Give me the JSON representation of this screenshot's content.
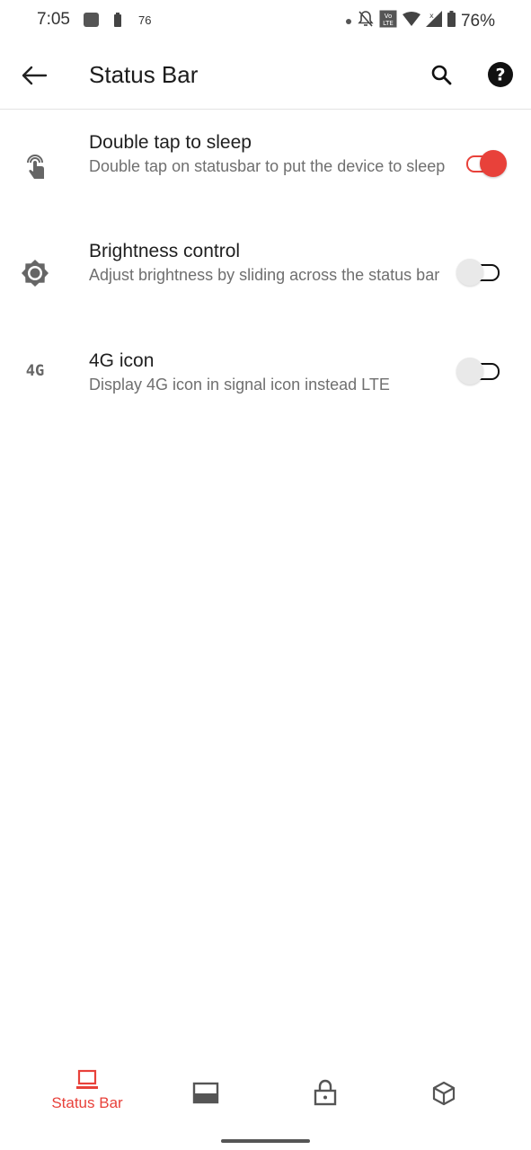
{
  "status_bar": {
    "time": "7:05",
    "notif_count": "76",
    "battery_percent": "76%",
    "icons": [
      "image-icon",
      "battery-small-icon",
      "dot-icon",
      "bell-off-icon",
      "volte-icon",
      "wifi-icon",
      "signal-icon",
      "battery-icon"
    ]
  },
  "app_bar": {
    "title": "Status Bar",
    "icons": [
      "back-arrow-icon",
      "search-icon",
      "help-icon"
    ]
  },
  "settings": [
    {
      "icon": "touch-icon",
      "title": "Double tap to sleep",
      "subtitle": "Double tap on statusbar to put the device to sleep",
      "enabled": true
    },
    {
      "icon": "brightness-icon",
      "title": "Brightness control",
      "subtitle": "Adjust brightness by sliding across the status bar",
      "enabled": false
    },
    {
      "icon": "4g-icon",
      "icon_text": "4G",
      "title": "4G icon",
      "subtitle": "Display 4G icon in signal icon instead LTE",
      "enabled": false
    }
  ],
  "bottom_nav": {
    "active_label": "Status Bar",
    "items": [
      "statusbar-nav-icon",
      "navbar-nav-icon",
      "lockscreen-nav-icon",
      "misc-nav-icon"
    ]
  },
  "colors": {
    "accent": "#e8413a",
    "text_primary": "#1f1f1f",
    "text_secondary": "#6f6f6f"
  }
}
